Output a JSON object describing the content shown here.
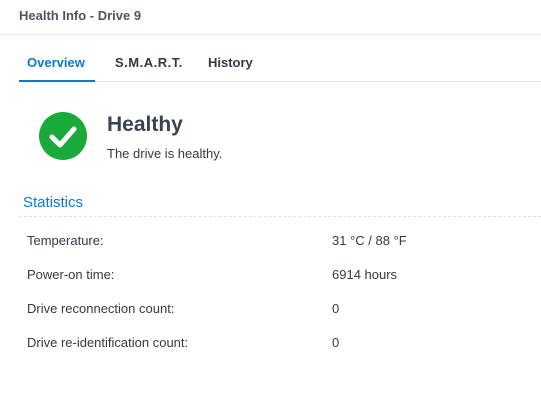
{
  "window": {
    "title": "Health Info - Drive 9"
  },
  "tabs": [
    {
      "label": "Overview",
      "active": true
    },
    {
      "label": "S.M.A.R.T.",
      "active": false
    },
    {
      "label": "History",
      "active": false
    }
  ],
  "status": {
    "icon": "check-circle-icon",
    "title": "Healthy",
    "description": "The drive is healthy.",
    "color": "#1aaa3a"
  },
  "statistics": {
    "title": "Statistics",
    "rows": [
      {
        "label": "Temperature:",
        "value": "31 °C / 88 °F"
      },
      {
        "label": "Power-on time:",
        "value": "6914 hours"
      },
      {
        "label": "Drive reconnection count:",
        "value": "0"
      },
      {
        "label": "Drive re-identification count:",
        "value": "0"
      }
    ]
  },
  "colors": {
    "accent": "#0a7ad0",
    "text": "#333a45"
  }
}
